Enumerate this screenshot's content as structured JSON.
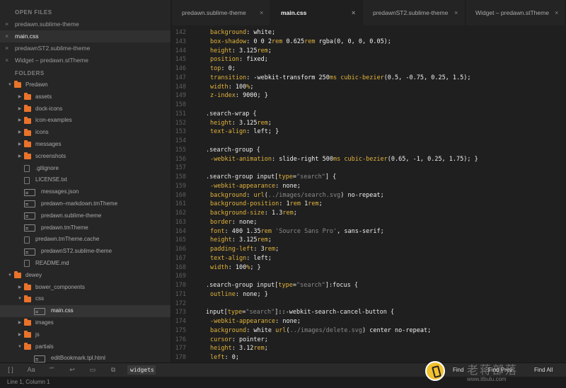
{
  "sidebar": {
    "open_files_header": "OPEN FILES",
    "open_files": [
      {
        "name": "predawn.sublime-theme",
        "active": false
      },
      {
        "name": "main.css",
        "active": true
      },
      {
        "name": "predawnST2.sublime-theme",
        "active": false
      },
      {
        "name": "Widget – predawn.stTheme",
        "active": false
      }
    ],
    "folders_header": "FOLDERS",
    "tree": [
      {
        "name": "Predawn",
        "type": "folder",
        "depth": 0,
        "expanded": true
      },
      {
        "name": "assets",
        "type": "folder",
        "depth": 1,
        "expanded": false
      },
      {
        "name": "dock-icons",
        "type": "folder",
        "depth": 1,
        "expanded": false
      },
      {
        "name": "icon-examples",
        "type": "folder",
        "depth": 1,
        "expanded": false
      },
      {
        "name": "icons",
        "type": "folder",
        "depth": 1,
        "expanded": false
      },
      {
        "name": "messages",
        "type": "folder",
        "depth": 1,
        "expanded": false
      },
      {
        "name": "screenshots",
        "type": "folder",
        "depth": 1,
        "expanded": false
      },
      {
        "name": ".gitignore",
        "type": "file",
        "depth": 1
      },
      {
        "name": "LICENSE.txt",
        "type": "file",
        "depth": 1
      },
      {
        "name": "messages.json",
        "type": "code",
        "depth": 1
      },
      {
        "name": "predawn–markdown.tmTheme",
        "type": "code",
        "depth": 1
      },
      {
        "name": "predawn.sublime-theme",
        "type": "code",
        "depth": 1
      },
      {
        "name": "predawn.tmTheme",
        "type": "code",
        "depth": 1
      },
      {
        "name": "predawn.tmTheme.cache",
        "type": "file",
        "depth": 1
      },
      {
        "name": "predawnST2.sublime-theme",
        "type": "code",
        "depth": 1
      },
      {
        "name": "README.md",
        "type": "file",
        "depth": 1
      },
      {
        "name": "dewey",
        "type": "folder",
        "depth": 0,
        "expanded": true
      },
      {
        "name": "bower_components",
        "type": "folder",
        "depth": 1,
        "expanded": false
      },
      {
        "name": "css",
        "type": "folder",
        "depth": 1,
        "expanded": true
      },
      {
        "name": "main.css",
        "type": "code",
        "depth": 2,
        "selected": true
      },
      {
        "name": "images",
        "type": "folder",
        "depth": 1,
        "expanded": false
      },
      {
        "name": "js",
        "type": "folder",
        "depth": 1,
        "expanded": false
      },
      {
        "name": "partials",
        "type": "folder",
        "depth": 1,
        "expanded": true
      },
      {
        "name": "editBookmark.tpl.html",
        "type": "code",
        "depth": 2
      }
    ]
  },
  "tabs": [
    {
      "label": "predawn.sublime-theme",
      "active": false
    },
    {
      "label": "main.css",
      "active": true
    },
    {
      "label": "predawnST2.sublime-theme",
      "active": false
    },
    {
      "label": "Widget – predawn.stTheme",
      "active": false
    }
  ],
  "code_lines": [
    {
      "n": "142",
      "ind": true,
      "tokens": [
        [
          "prop",
          "background"
        ],
        [
          "val",
          ": white;"
        ]
      ]
    },
    {
      "n": "143",
      "ind": true,
      "tokens": [
        [
          "prop",
          "box-shadow"
        ],
        [
          "val",
          ": 0 0 2"
        ],
        [
          "unit",
          "rem"
        ],
        [
          "val",
          " 0.625"
        ],
        [
          "unit",
          "rem"
        ],
        [
          "val",
          " rgba(0, 0, 0, 0.05);"
        ]
      ]
    },
    {
      "n": "144",
      "ind": true,
      "tokens": [
        [
          "prop",
          "height"
        ],
        [
          "val",
          ": 3.125"
        ],
        [
          "unit",
          "rem"
        ],
        [
          "val",
          ";"
        ]
      ]
    },
    {
      "n": "145",
      "ind": true,
      "tokens": [
        [
          "prop",
          "position"
        ],
        [
          "val",
          ": fixed;"
        ]
      ]
    },
    {
      "n": "146",
      "ind": true,
      "tokens": [
        [
          "prop",
          "top"
        ],
        [
          "val",
          ": 0;"
        ]
      ]
    },
    {
      "n": "147",
      "ind": true,
      "tokens": [
        [
          "prop",
          "transition"
        ],
        [
          "val",
          ": -webkit-transform 250"
        ],
        [
          "unit",
          "ms"
        ],
        [
          "val",
          " "
        ],
        [
          "kw",
          "cubic-bezier"
        ],
        [
          "val",
          "(0.5, -0.75, 0.25, 1.5);"
        ]
      ]
    },
    {
      "n": "148",
      "ind": true,
      "tokens": [
        [
          "prop",
          "width"
        ],
        [
          "val",
          ": 100"
        ],
        [
          "unit",
          "%"
        ],
        [
          "val",
          ";"
        ]
      ]
    },
    {
      "n": "149",
      "ind": true,
      "tokens": [
        [
          "prop",
          "z-index"
        ],
        [
          "val",
          ": 9000; }"
        ]
      ]
    },
    {
      "n": "150",
      "ind": false,
      "tokens": []
    },
    {
      "n": "151",
      "ind": false,
      "tokens": [
        [
          "sel",
          ".search-wrap {"
        ]
      ]
    },
    {
      "n": "152",
      "ind": true,
      "tokens": [
        [
          "prop",
          "height"
        ],
        [
          "val",
          ": 3.125"
        ],
        [
          "unit",
          "rem"
        ],
        [
          "val",
          ";"
        ]
      ]
    },
    {
      "n": "153",
      "ind": true,
      "tokens": [
        [
          "prop",
          "text-align"
        ],
        [
          "val",
          ": left; }"
        ]
      ]
    },
    {
      "n": "154",
      "ind": false,
      "tokens": []
    },
    {
      "n": "155",
      "ind": false,
      "tokens": [
        [
          "sel",
          ".search-group {"
        ]
      ]
    },
    {
      "n": "156",
      "ind": true,
      "tokens": [
        [
          "prop",
          "-webkit-animation"
        ],
        [
          "val",
          ": slide-right 500"
        ],
        [
          "unit",
          "ms"
        ],
        [
          "val",
          " "
        ],
        [
          "kw",
          "cubic-bezier"
        ],
        [
          "val",
          "(0.65, -1, 0.25, 1.75); }"
        ]
      ]
    },
    {
      "n": "157",
      "ind": false,
      "tokens": []
    },
    {
      "n": "158",
      "ind": false,
      "tokens": [
        [
          "sel",
          ".search-group input["
        ],
        [
          "prop",
          "type"
        ],
        [
          "sel",
          "="
        ],
        [
          "str",
          "\"search\""
        ],
        [
          "sel",
          "] {"
        ]
      ]
    },
    {
      "n": "159",
      "ind": true,
      "tokens": [
        [
          "prop",
          "-webkit-appearance"
        ],
        [
          "val",
          ": none;"
        ]
      ]
    },
    {
      "n": "160",
      "ind": true,
      "tokens": [
        [
          "prop",
          "background"
        ],
        [
          "val",
          ": "
        ],
        [
          "kw",
          "url"
        ],
        [
          "val",
          "("
        ],
        [
          "str",
          "../images/search.svg"
        ],
        [
          "val",
          ") no-repeat;"
        ]
      ]
    },
    {
      "n": "161",
      "ind": true,
      "tokens": [
        [
          "prop",
          "background-position"
        ],
        [
          "val",
          ": 1"
        ],
        [
          "unit",
          "rem"
        ],
        [
          "val",
          " 1"
        ],
        [
          "unit",
          "rem"
        ],
        [
          "val",
          ";"
        ]
      ]
    },
    {
      "n": "162",
      "ind": true,
      "tokens": [
        [
          "prop",
          "background-size"
        ],
        [
          "val",
          ": 1.3"
        ],
        [
          "unit",
          "rem"
        ],
        [
          "val",
          ";"
        ]
      ]
    },
    {
      "n": "163",
      "ind": true,
      "tokens": [
        [
          "prop",
          "border"
        ],
        [
          "val",
          ": none;"
        ]
      ]
    },
    {
      "n": "164",
      "ind": true,
      "tokens": [
        [
          "prop",
          "font"
        ],
        [
          "val",
          ": 400 1.35"
        ],
        [
          "unit",
          "rem"
        ],
        [
          "val",
          " "
        ],
        [
          "str",
          "'Source Sans Pro'"
        ],
        [
          "val",
          ", sans-serif;"
        ]
      ]
    },
    {
      "n": "165",
      "ind": true,
      "tokens": [
        [
          "prop",
          "height"
        ],
        [
          "val",
          ": 3.125"
        ],
        [
          "unit",
          "rem"
        ],
        [
          "val",
          ";"
        ]
      ]
    },
    {
      "n": "166",
      "ind": true,
      "tokens": [
        [
          "prop",
          "padding-left"
        ],
        [
          "val",
          ": 3"
        ],
        [
          "unit",
          "rem"
        ],
        [
          "val",
          ";"
        ]
      ]
    },
    {
      "n": "167",
      "ind": true,
      "tokens": [
        [
          "prop",
          "text-align"
        ],
        [
          "val",
          ": left;"
        ]
      ]
    },
    {
      "n": "168",
      "ind": true,
      "tokens": [
        [
          "prop",
          "width"
        ],
        [
          "val",
          ": 100"
        ],
        [
          "unit",
          "%"
        ],
        [
          "val",
          "; }"
        ]
      ]
    },
    {
      "n": "169",
      "ind": false,
      "tokens": []
    },
    {
      "n": "170",
      "ind": false,
      "tokens": [
        [
          "sel",
          ".search-group input["
        ],
        [
          "prop",
          "type"
        ],
        [
          "sel",
          "="
        ],
        [
          "str",
          "\"search\""
        ],
        [
          "sel",
          "]:focus {"
        ]
      ]
    },
    {
      "n": "171",
      "ind": true,
      "tokens": [
        [
          "prop",
          "outline"
        ],
        [
          "val",
          ": none; }"
        ]
      ]
    },
    {
      "n": "172",
      "ind": false,
      "tokens": []
    },
    {
      "n": "173",
      "ind": false,
      "tokens": [
        [
          "sel",
          "input["
        ],
        [
          "prop",
          "type"
        ],
        [
          "sel",
          "="
        ],
        [
          "str",
          "\"search\""
        ],
        [
          "sel",
          "]::-webkit-search-cancel-button {"
        ]
      ]
    },
    {
      "n": "174",
      "ind": true,
      "tokens": [
        [
          "prop",
          "-webkit-appearance"
        ],
        [
          "val",
          ": none;"
        ]
      ]
    },
    {
      "n": "175",
      "ind": true,
      "tokens": [
        [
          "prop",
          "background"
        ],
        [
          "val",
          ": white "
        ],
        [
          "kw",
          "url"
        ],
        [
          "val",
          "("
        ],
        [
          "str",
          "../images/delete.svg"
        ],
        [
          "val",
          ") center no-repeat;"
        ]
      ]
    },
    {
      "n": "176",
      "ind": true,
      "tokens": [
        [
          "prop",
          "cursor"
        ],
        [
          "val",
          ": pointer;"
        ]
      ]
    },
    {
      "n": "177",
      "ind": true,
      "tokens": [
        [
          "prop",
          "height"
        ],
        [
          "val",
          ": 3.12"
        ],
        [
          "unit",
          "rem"
        ],
        [
          "val",
          ";"
        ]
      ]
    },
    {
      "n": "178",
      "ind": true,
      "tokens": [
        [
          "prop",
          "left"
        ],
        [
          "val",
          ": 0;"
        ]
      ]
    }
  ],
  "findbar": {
    "query": "widgets",
    "find_label": "Find",
    "find_prev_label": "Find Prev",
    "find_all_label": "Find All",
    "option_icons": [
      "regex-icon",
      "case-icon",
      "whole-word-icon",
      "wrap-icon",
      "in-selection-icon",
      "highlight-icon"
    ]
  },
  "status": {
    "position": "Line 1, Column 1"
  },
  "watermark": {
    "text": "老蒋部落",
    "url": "www.itbulu.com"
  },
  "colors": {
    "accent": "#e9732a",
    "keyword": "#e2b33c",
    "string": "#8a8a8a",
    "background": "#1f1f1f"
  }
}
